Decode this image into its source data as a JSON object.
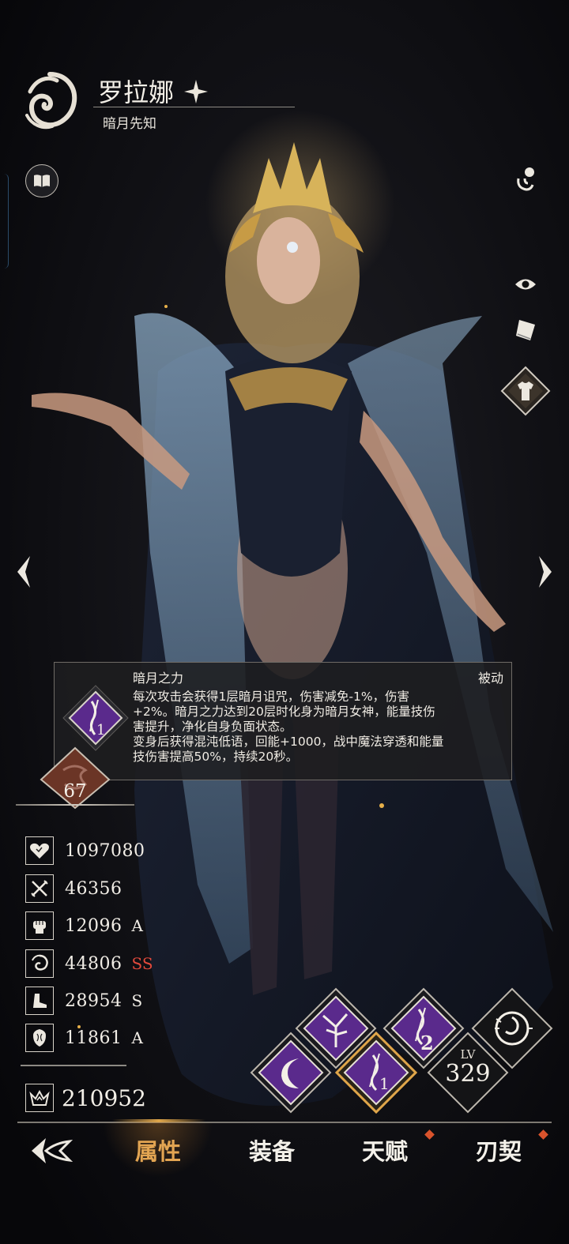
{
  "hero": {
    "name": "罗拉娜",
    "title": "暗月先知"
  },
  "tooltip": {
    "skill_name": "暗月之力",
    "skill_type": "被动",
    "description_line1": "每次攻击会获得1层暗月诅咒，伤害减免-1%，伤害",
    "description_line2": "+2%。暗月之力达到20层时化身为暗月女神，能量技伤",
    "description_line3": "害提升，净化自身负面状态。",
    "description_line4": "变身后获得混沌低语，回能+1000，战中魔法穿透和能量",
    "description_line5": "技伤害提高50%，持续20秒。",
    "skill_level": "1"
  },
  "rank_badge": {
    "value": "67"
  },
  "stats": [
    {
      "icon": "heart-icon",
      "value": "1097080",
      "grade": ""
    },
    {
      "icon": "sword-icon",
      "value": "46356",
      "grade": ""
    },
    {
      "icon": "fist-icon",
      "value": "12096",
      "grade": "A"
    },
    {
      "icon": "vortex-icon",
      "value": "44806",
      "grade": "SS"
    },
    {
      "icon": "boot-icon",
      "value": "28954",
      "grade": "S"
    },
    {
      "icon": "armor-icon",
      "value": "11861",
      "grade": "A"
    }
  ],
  "power": {
    "value": "210952"
  },
  "skills": {
    "level_label": "LV",
    "level_value": "329",
    "badge_1": "1",
    "badge_2": "2"
  },
  "tabs": {
    "attributes": "属性",
    "equipment": "装备",
    "talent": "天赋",
    "blade_pact": "刃契"
  },
  "colors": {
    "accent_gold": "#e0a64a",
    "grade_ss": "#e0493c",
    "skill_purple": "#5a2a8c",
    "notification_dot": "#d9532c"
  }
}
